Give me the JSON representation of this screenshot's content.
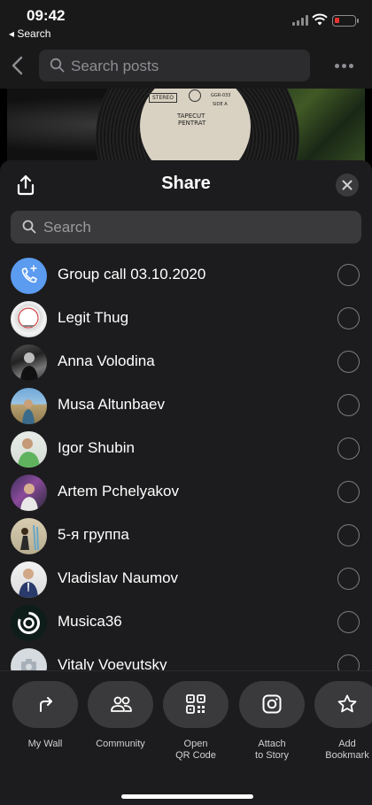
{
  "status": {
    "time": "09:42",
    "back_app": "◂ Search"
  },
  "topnav": {
    "search_placeholder": "Search posts"
  },
  "post_image": {
    "stereo": "STEREO",
    "catalog": "GGR-033",
    "side": "SIDE A",
    "title_line1": "TAPECUT",
    "title_line2": "PENTRAT"
  },
  "sheet": {
    "title": "Share",
    "search_placeholder": "Search",
    "contacts": [
      {
        "name": "Group call 03.10.2020",
        "avatar": "phone-icon"
      },
      {
        "name": "Legit Thug",
        "avatar": "user-avatar"
      },
      {
        "name": "Anna Volodina",
        "avatar": "user-avatar"
      },
      {
        "name": "Musa Altunbaev",
        "avatar": "user-avatar"
      },
      {
        "name": "Igor Shubin",
        "avatar": "user-avatar"
      },
      {
        "name": "Artem Pchelyakov",
        "avatar": "user-avatar"
      },
      {
        "name": "5-я группа",
        "avatar": "group-avatar"
      },
      {
        "name": "Vladislav Naumov",
        "avatar": "user-avatar"
      },
      {
        "name": "Musica36",
        "avatar": "user-avatar"
      },
      {
        "name": "Vitaly Voevutsky",
        "avatar": "camera-icon"
      }
    ]
  },
  "actions": [
    {
      "label": "My Wall",
      "icon": "redo-arrow-icon"
    },
    {
      "label": "Community",
      "icon": "people-icon"
    },
    {
      "label": "Open\nQR Code",
      "icon": "qr-code-icon"
    },
    {
      "label": "Attach\nto Story",
      "icon": "instagram-icon"
    },
    {
      "label": "Add\nBookmark",
      "icon": "star-icon"
    }
  ],
  "colors": {
    "sheet_bg": "#1c1c1e",
    "control_bg": "#3a3a3c",
    "group_call_avatar": "#5b9bf0",
    "battery_low": "#e8322e"
  }
}
